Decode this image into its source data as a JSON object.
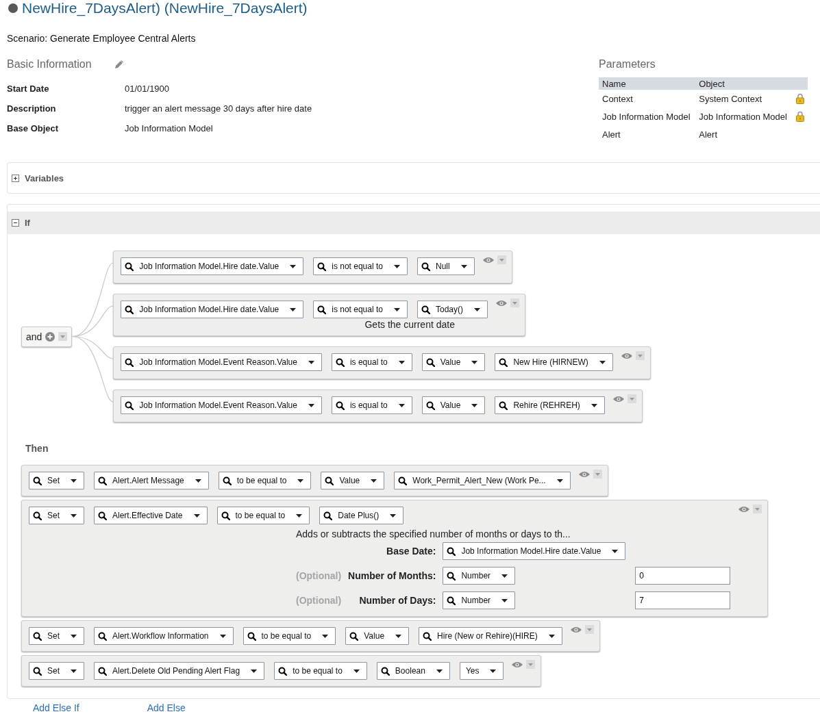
{
  "title": "NewHire_7DaysAlert) (NewHire_7DaysAlert)",
  "scenario": "Scenario: Generate Employee Central Alerts",
  "basic_information": {
    "heading": "Basic Information",
    "fields": [
      {
        "label": "Start Date",
        "value": "01/01/1900"
      },
      {
        "label": "Description",
        "value": "trigger an alert message 30 days after hire date"
      },
      {
        "label": "Base Object",
        "value": "Job Information Model"
      }
    ]
  },
  "parameters": {
    "heading": "Parameters",
    "columns": [
      "Name",
      "Object"
    ],
    "rows": [
      {
        "name": "Context",
        "object": "System Context",
        "locked": true
      },
      {
        "name": "Job Information Model",
        "object": "Job Information Model",
        "locked": true
      },
      {
        "name": "Alert",
        "object": "Alert",
        "locked": false
      }
    ]
  },
  "variables": {
    "label": "Variables",
    "expanded": false
  },
  "if_section": {
    "label": "If",
    "expanded": true,
    "operator": "and",
    "conditions": [
      {
        "dropdowns": [
          {
            "text": "Job Information Model.Hire date.Value",
            "search": true
          },
          {
            "text": "is not equal to",
            "search": true
          },
          {
            "text": "Null",
            "search": true
          }
        ]
      },
      {
        "dropdowns": [
          {
            "text": "Job Information Model.Hire date.Value",
            "search": true
          },
          {
            "text": "is not equal to",
            "search": true
          },
          {
            "text": "Today()",
            "search": true
          }
        ],
        "description": "Gets the current date"
      },
      {
        "dropdowns": [
          {
            "text": "Job Information Model.Event Reason.Value",
            "search": true
          },
          {
            "text": "is equal to",
            "search": true
          },
          {
            "text": "Value",
            "search": true
          },
          {
            "text": "New Hire (HIRNEW)",
            "search": true
          }
        ]
      },
      {
        "dropdowns": [
          {
            "text": "Job Information Model.Event Reason.Value",
            "search": true
          },
          {
            "text": "is equal to",
            "search": true
          },
          {
            "text": "Value",
            "search": true
          },
          {
            "text": "Rehire (REHREH)",
            "search": true
          }
        ]
      }
    ]
  },
  "then": {
    "label": "Then",
    "actions": [
      {
        "dropdowns": [
          {
            "text": "Set",
            "search": true
          },
          {
            "text": "Alert.Alert Message",
            "search": true
          },
          {
            "text": "to be equal to",
            "search": true
          },
          {
            "text": "Value",
            "search": true
          },
          {
            "text": "Work_Permit_Alert_New (Work Pe...",
            "search": true
          }
        ]
      },
      {
        "dropdowns": [
          {
            "text": "Set",
            "search": true
          },
          {
            "text": "Alert.Effective Date",
            "search": true
          },
          {
            "text": "to be equal to",
            "search": true
          },
          {
            "text": "Date Plus()",
            "search": true
          }
        ],
        "description": "Adds or subtracts the specified number of months or days to th...",
        "params": [
          {
            "label": "Base Date:",
            "dropdown": {
              "text": "Job Information Model.Hire date.Value",
              "search": true
            }
          },
          {
            "optional": "(Optional)",
            "label": "Number of Months:",
            "dropdown": {
              "text": "Number",
              "search": true
            },
            "value": "0"
          },
          {
            "optional": "(Optional)",
            "label": "Number of Days:",
            "dropdown": {
              "text": "Number",
              "search": true
            },
            "value": "7"
          }
        ]
      },
      {
        "dropdowns": [
          {
            "text": "Set",
            "search": true
          },
          {
            "text": "Alert.Workflow Information",
            "search": true
          },
          {
            "text": "to be equal to",
            "search": true
          },
          {
            "text": "Value",
            "search": true
          },
          {
            "text": "Hire (New or Rehire)(HIRE)",
            "search": true
          }
        ]
      },
      {
        "dropdowns": [
          {
            "text": "Set",
            "search": true
          },
          {
            "text": "Alert.Delete Old Pending Alert Flag",
            "search": true
          },
          {
            "text": "to be equal to",
            "search": true
          },
          {
            "text": "Boolean",
            "search": true
          },
          {
            "text": "Yes",
            "search": false
          }
        ]
      }
    ]
  },
  "links": [
    "Add Else If",
    "Add Else"
  ]
}
